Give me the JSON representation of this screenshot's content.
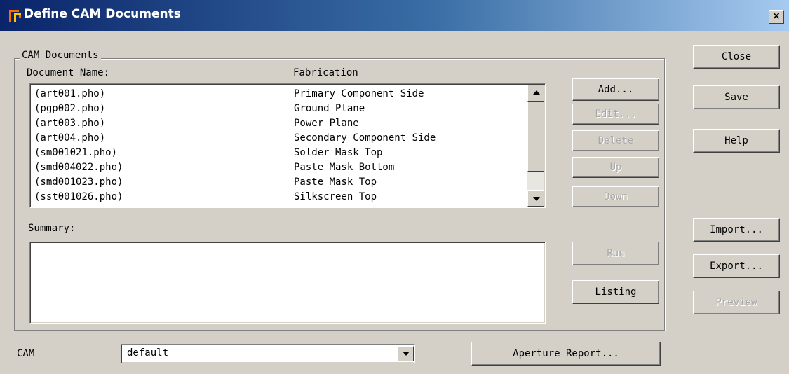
{
  "window": {
    "title": "Define CAM Documents",
    "close_glyph": "×"
  },
  "group": {
    "title": "CAM Documents",
    "doc_name_header": "Document Name:",
    "fabrication_header": "Fabrication",
    "summary_label": "Summary:"
  },
  "documents": [
    {
      "name": "(art001.pho)",
      "fabrication": "Primary Component Side"
    },
    {
      "name": "(pgp002.pho)",
      "fabrication": "Ground Plane"
    },
    {
      "name": "(art003.pho)",
      "fabrication": "Power Plane"
    },
    {
      "name": "(art004.pho)",
      "fabrication": "Secondary Component Side"
    },
    {
      "name": "(sm001021.pho)",
      "fabrication": "Solder Mask Top"
    },
    {
      "name": "(smd004022.pho)",
      "fabrication": "Paste Mask Bottom"
    },
    {
      "name": "(smd001023.pho)",
      "fabrication": "Paste Mask Top"
    },
    {
      "name": "(sst001026.pho)",
      "fabrication": "Silkscreen Top"
    }
  ],
  "summary": {
    "text": ""
  },
  "buttons": {
    "add": "Add...",
    "edit": "Edit...",
    "delete": "Delete",
    "up": "Up",
    "down": "Down",
    "run": "Run",
    "listing": "Listing",
    "close": "Close",
    "save": "Save",
    "help": "Help",
    "import": "Import...",
    "export": "Export...",
    "preview": "Preview",
    "aperture_report": "Aperture Report..."
  },
  "cam": {
    "label": "CAM",
    "value": "default"
  },
  "icons": {
    "app": "cam-app-icon",
    "scroll_up": "triangle-up-icon",
    "scroll_down": "triangle-down-icon",
    "combo": "triangle-down-icon"
  },
  "colors": {
    "titlebar_start": "#0a246a",
    "titlebar_end": "#a6caf0",
    "face": "#d4d0c8",
    "disabled_text": "#a8a8a8"
  }
}
